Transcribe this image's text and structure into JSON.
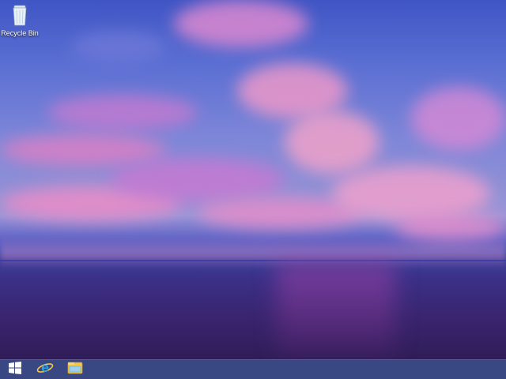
{
  "desktop": {
    "icons": [
      {
        "label": "Recycle Bin",
        "icon": "recycle-bin-icon"
      }
    ]
  },
  "taskbar": {
    "items": [
      {
        "icon": "windows-start-icon"
      },
      {
        "icon": "internet-explorer-icon"
      },
      {
        "icon": "file-explorer-icon"
      }
    ]
  },
  "colors": {
    "taskbar": "#28377a",
    "sky_top": "#3f55c4",
    "cloud_pink": "#f08cc6",
    "sea": "#3a2570"
  }
}
